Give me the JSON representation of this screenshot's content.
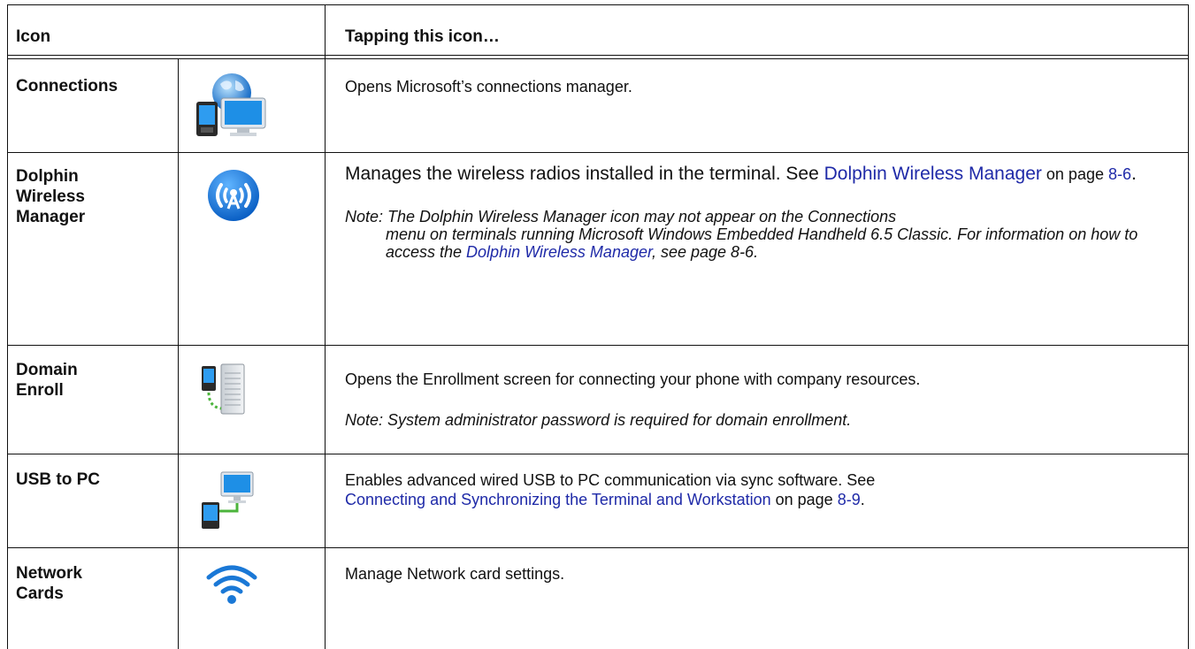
{
  "header": {
    "col1": "Icon",
    "col2": "Tapping this icon…"
  },
  "rows": [
    {
      "name": "Connections",
      "icon": "globe-phone-monitor-icon",
      "desc": "Opens Microsoft’s connections manager."
    },
    {
      "name_lines": [
        "Dolphin",
        "Wireless",
        "Manager"
      ],
      "icon": "wireless-radio-icon",
      "desc_prefix": "Manages the wireless radios installed in the terminal. See ",
      "desc_link": "Dolphin Wireless Manager",
      "desc_mid": " on page ",
      "desc_page": "8-6",
      "desc_suffix": ".",
      "note_prefix": "Note: The Dolphin Wireless Manager icon may not appear on the Connections",
      "note_cont_a": "menu on terminals running Microsoft Windows Embedded Handheld 6.5 Classic. For information on how to access the ",
      "note_link": "Dolphin Wireless Manager",
      "note_cont_b": ", see page 8-6."
    },
    {
      "name_lines": [
        "Domain",
        "Enroll"
      ],
      "icon": "phone-server-icon",
      "desc": "Opens the Enrollment screen for connecting your phone with company resources.",
      "note": "Note: System administrator password is required for domain enrollment."
    },
    {
      "name": "USB to PC",
      "icon": "usb-phone-pc-icon",
      "desc_prefix": "Enables advanced wired USB to PC communication via sync software. See",
      "desc_link": "Connecting and Synchronizing the Terminal and Workstation",
      "desc_mid": " on page ",
      "desc_page": "8-9",
      "desc_suffix": "."
    },
    {
      "name_lines": [
        "Network",
        "Cards"
      ],
      "icon": "wifi-icon",
      "desc": "Manage Network card settings."
    }
  ],
  "colors": {
    "link": "#1f2aa8",
    "icon_blue": "#1a78d6",
    "border": "#111111"
  }
}
